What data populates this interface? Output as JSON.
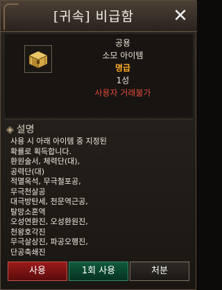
{
  "window": {
    "title": "[귀속] 비급함",
    "close_symbol": "✕"
  },
  "item": {
    "icon": "golden-treasure-chest-icon",
    "category": "공용",
    "type": "소모 아이템",
    "grade": "명급",
    "stars": "1성",
    "trade_restriction": "사용자 거래불가"
  },
  "description": {
    "header": "설명",
    "lines": [
      "사용 시 아래 아이템 중 지정된",
      "확률로 획득합니다.",
      "환원술서, 체력단(대),",
      "공력단(대)",
      "적멸옥석, 무극철포공,",
      "무극천살공",
      "대극방탄세, 천문역근공,",
      "탈망소혼역",
      "오성연환진, 오성환원진,",
      "천왕호각진",
      "무극살상진, 파공오행진,",
      "단공축쇄진"
    ]
  },
  "buttons": {
    "use": "사용",
    "use_once": "1회 사용",
    "discard": "처분"
  },
  "colors": {
    "grade": "#ffae2a",
    "restriction": "#e04a3a",
    "use_button": "#9b1a1a",
    "use_once_button": "#0f5a3c"
  }
}
